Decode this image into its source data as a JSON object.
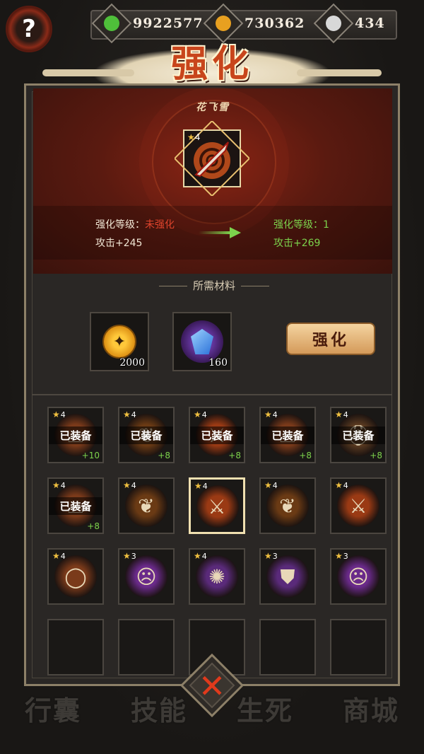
{
  "currencies": [
    {
      "icon": "jade-icon",
      "value": "9922577",
      "color": "#4fbf3a"
    },
    {
      "icon": "gold-coin-icon",
      "value": "730362",
      "color": "#e8a020"
    },
    {
      "icon": "silver-icon",
      "value": "434",
      "color": "#d8d8d8"
    }
  ],
  "help_label": "?",
  "title": "强化",
  "item": {
    "name": "花飞雪",
    "stars": "4"
  },
  "stats": {
    "current_level_label": "强化等级：",
    "current_level_value": "未强化",
    "current_attack": "攻击+245",
    "next_level": "强化等级：1",
    "next_attack": "攻击+269"
  },
  "materials_title": "所需材料",
  "materials": [
    {
      "icon": "coin-icon",
      "count": "2000"
    },
    {
      "icon": "gem-icon",
      "count": "160"
    }
  ],
  "upgrade_label": "强化",
  "equipped_label": "已装备",
  "inventory": [
    {
      "stars": "4",
      "equipped": true,
      "plus": "+10",
      "kind": "hat"
    },
    {
      "stars": "4",
      "equipped": true,
      "plus": "+8",
      "kind": "pendant"
    },
    {
      "stars": "4",
      "equipped": true,
      "plus": "+8",
      "kind": "sword"
    },
    {
      "stars": "4",
      "equipped": true,
      "plus": "+8",
      "kind": "hat"
    },
    {
      "stars": "4",
      "equipped": true,
      "plus": "+8",
      "kind": "helmet"
    },
    {
      "stars": "4",
      "equipped": true,
      "plus": "+8",
      "kind": "hat"
    },
    {
      "stars": "4",
      "equipped": false,
      "plus": "",
      "kind": "pendant"
    },
    {
      "stars": "4",
      "equipped": false,
      "plus": "",
      "kind": "sword",
      "selected": true
    },
    {
      "stars": "4",
      "equipped": false,
      "plus": "",
      "kind": "pendant"
    },
    {
      "stars": "4",
      "equipped": false,
      "plus": "",
      "kind": "sword"
    },
    {
      "stars": "4",
      "equipped": false,
      "plus": "",
      "kind": "bracelet"
    },
    {
      "stars": "3",
      "equipped": false,
      "plus": "",
      "kind": "mask"
    },
    {
      "stars": "4",
      "equipped": false,
      "plus": "",
      "kind": "amulet"
    },
    {
      "stars": "3",
      "equipped": false,
      "plus": "",
      "kind": "armor"
    },
    {
      "stars": "3",
      "equipped": false,
      "plus": "",
      "kind": "mask"
    }
  ],
  "bottom_nav": [
    "行囊",
    "技能",
    "生死",
    "商城"
  ]
}
